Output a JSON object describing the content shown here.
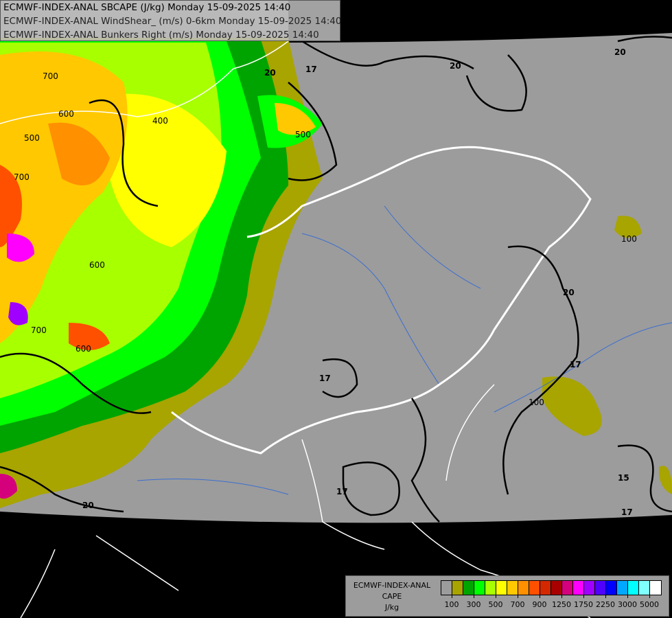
{
  "titles": [
    "ECMWF-INDEX-ANAL SBCAPE (J/kg) Monday 15-09-2025 14:40",
    "ECMWF-INDEX-ANAL WindShear_ (m/s) 0-6km Monday 15-09-2025 14:40",
    "ECMWF-INDEX-ANAL Bunkers Right (m/s) Monday 15-09-2025 14:40"
  ],
  "legend": {
    "title_lines": [
      "ECMWF-INDEX-ANAL",
      "CAPE",
      "J/kg"
    ],
    "colors": [
      "#9c9c9c",
      "#a8a400",
      "#00a400",
      "#00ff00",
      "#a8ff00",
      "#ffff00",
      "#ffc800",
      "#ff9000",
      "#ff5000",
      "#d42800",
      "#a80000",
      "#d4007c",
      "#ff00ff",
      "#a000ff",
      "#5000ff",
      "#0000ff",
      "#00a8ff",
      "#00ffff",
      "#80ffff",
      "#ffffff"
    ],
    "tick_labels": [
      "100",
      "300",
      "500",
      "700",
      "900",
      "1250",
      "1750",
      "2250",
      "3000",
      "5000"
    ]
  },
  "contour_labels": {
    "shear": [
      "20",
      "20",
      "20",
      "17",
      "17",
      "17",
      "17",
      "15",
      "20",
      "20",
      "17"
    ],
    "cape": [
      "700",
      "600",
      "500",
      "400",
      "700",
      "600",
      "500",
      "100",
      "100",
      "600",
      "700"
    ]
  }
}
